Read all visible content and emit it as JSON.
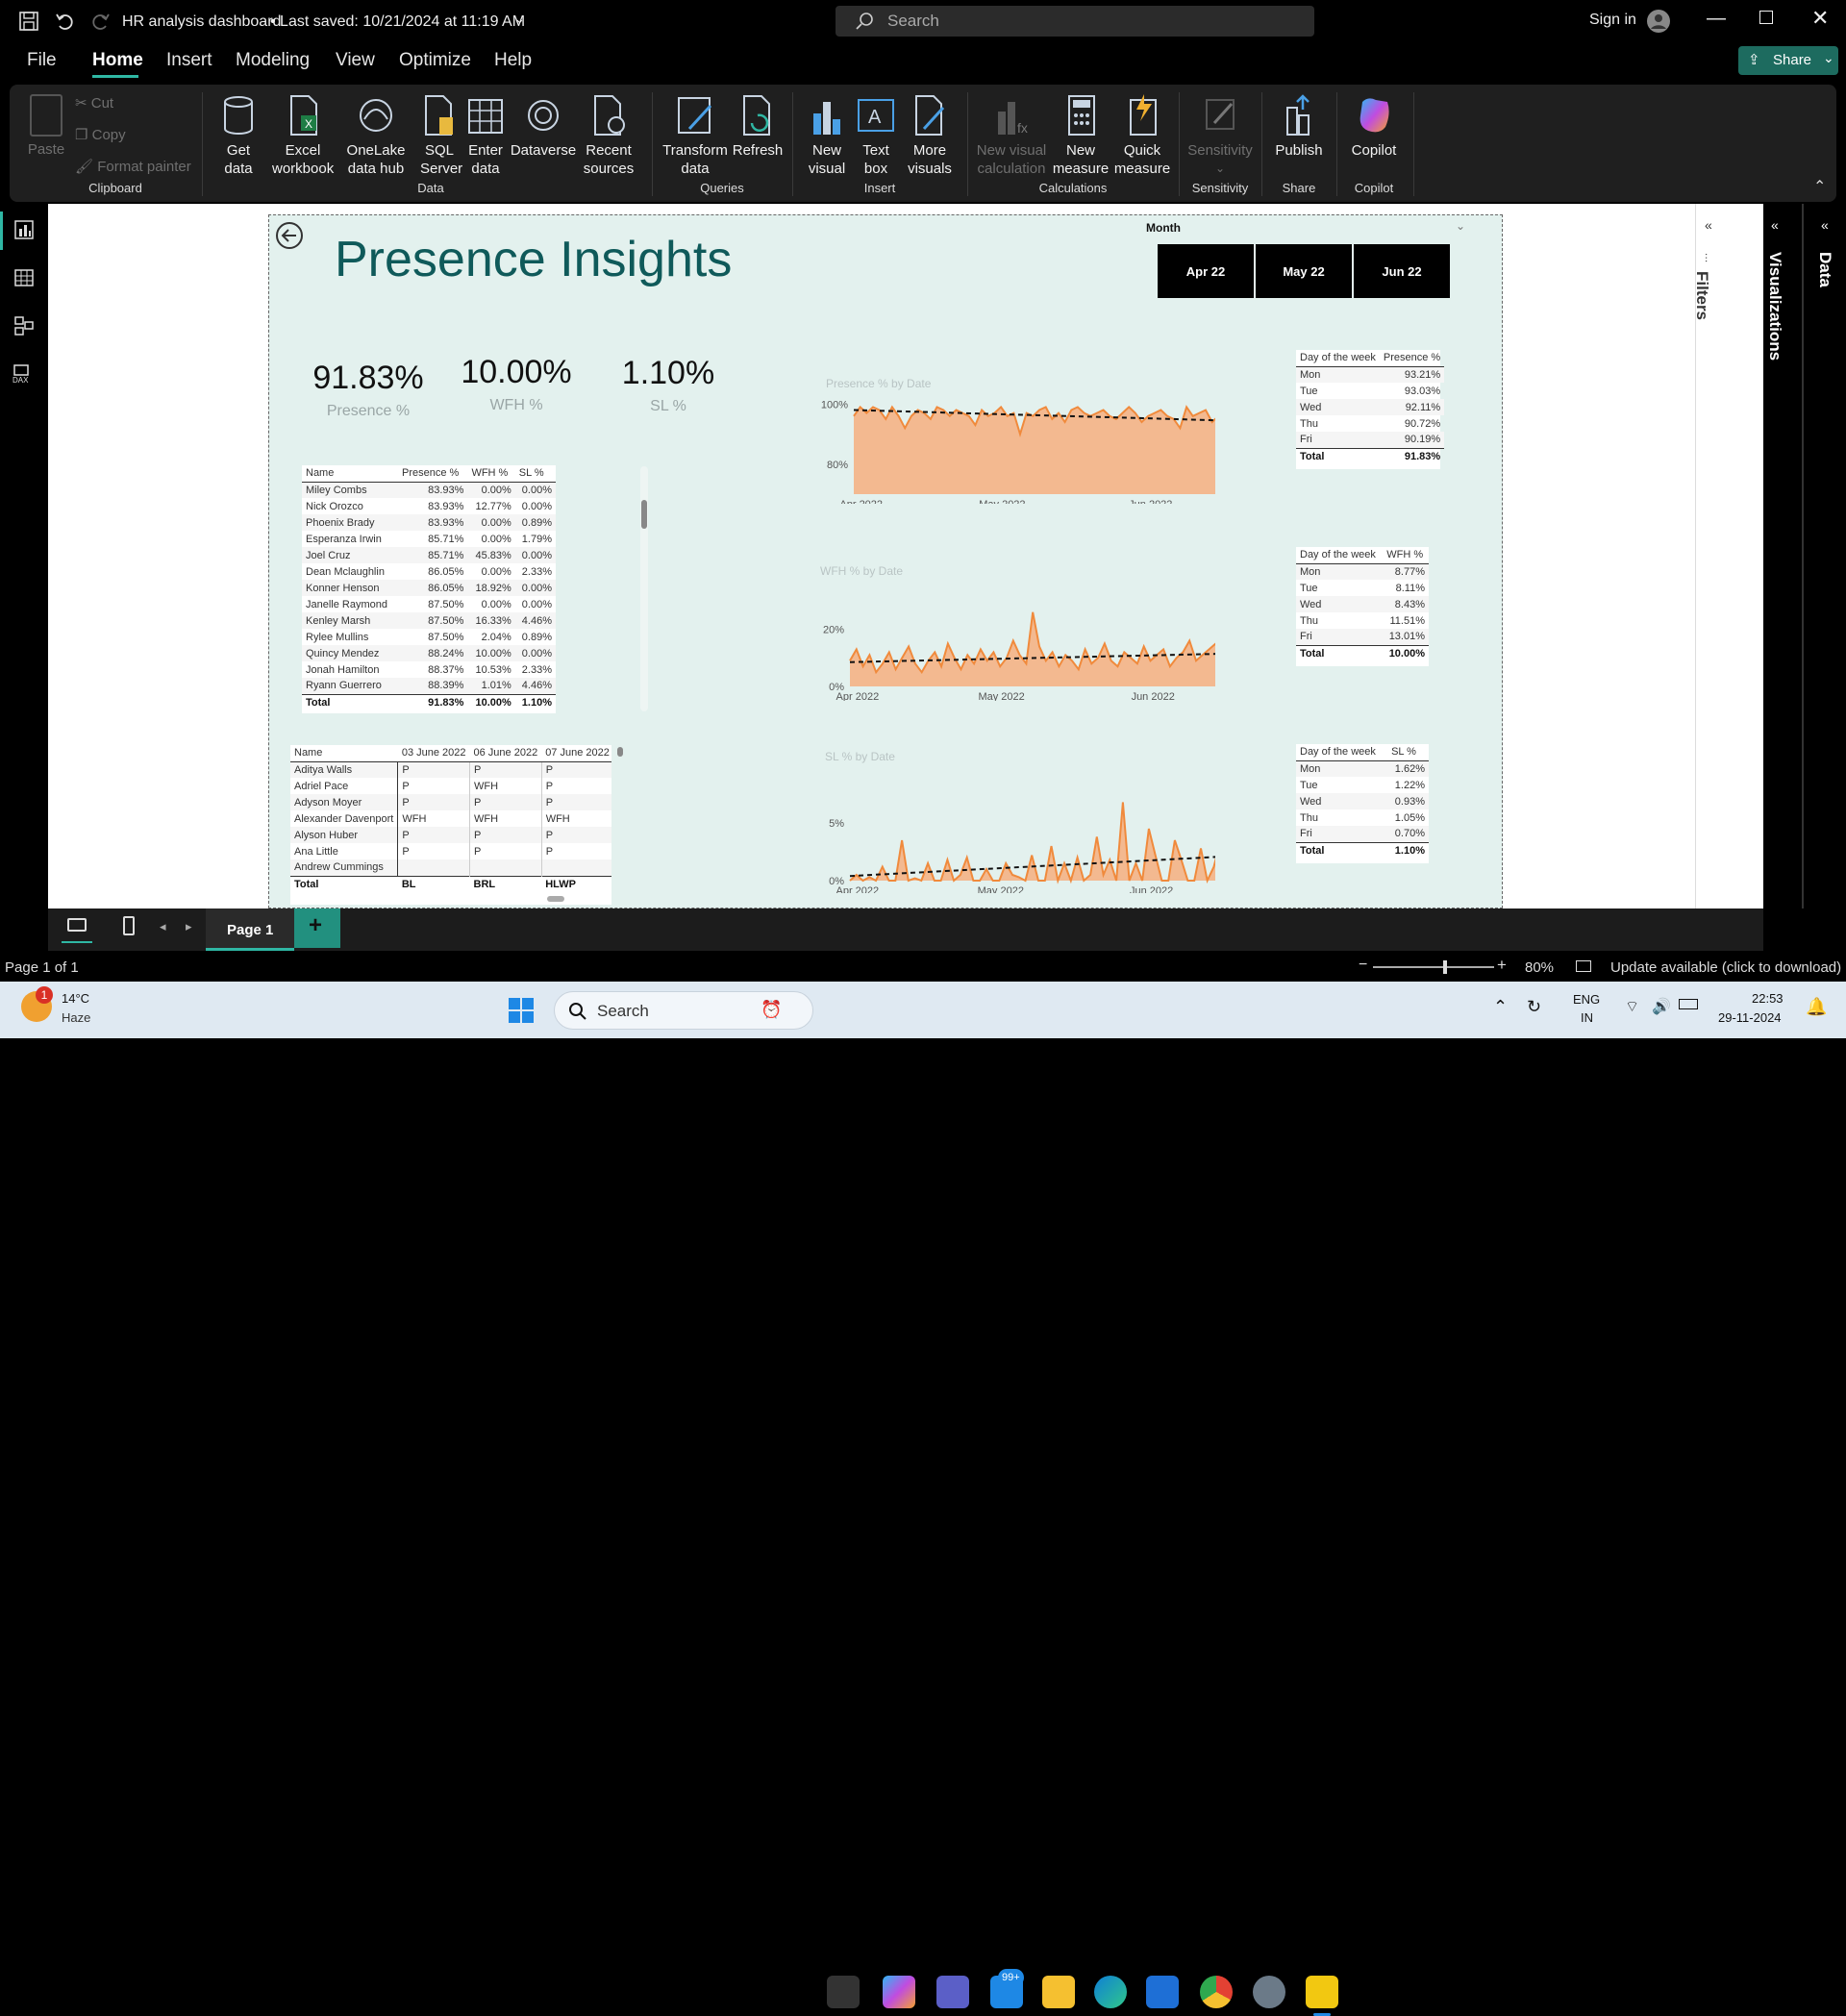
{
  "titlebar": {
    "title": "HR analysis dashboard",
    "saved": "• Last saved: 10/21/2024 at 11:19 AM",
    "search_placeholder": "Search",
    "signin": "Sign in"
  },
  "menu": {
    "items": [
      "File",
      "Home",
      "Insert",
      "Modeling",
      "View",
      "Optimize",
      "Help"
    ],
    "share": "Share"
  },
  "ribbon": {
    "clipboard": {
      "paste": "Paste",
      "cut": "Cut",
      "copy": "Copy",
      "format_painter": "Format painter",
      "group": "Clipboard"
    },
    "data": {
      "get_data": "Get data",
      "excel": "Excel workbook",
      "onelake": "OneLake data hub",
      "sql": "SQL Server",
      "enter": "Enter data",
      "dataverse": "Dataverse",
      "recent": "Recent sources",
      "group": "Data"
    },
    "queries": {
      "transform": "Transform data",
      "refresh": "Refresh",
      "group": "Queries"
    },
    "insert": {
      "new_visual": "New visual",
      "text_box": "Text box",
      "more_visuals": "More visuals",
      "group": "Insert"
    },
    "calculations": {
      "new_visual_calc": "New visual calculation",
      "new_measure": "New measure",
      "quick_measure": "Quick measure",
      "group": "Calculations"
    },
    "sensitivity": {
      "label": "Sensitivity",
      "group": "Sensitivity"
    },
    "share": {
      "publish": "Publish",
      "group": "Share"
    },
    "copilot": {
      "label": "Copilot",
      "group": "Copilot"
    }
  },
  "report": {
    "title": "Presence Insights",
    "month_label": "Month",
    "months": [
      "Apr 22",
      "May 22",
      "Jun 22"
    ],
    "kpis": [
      {
        "value": "91.83%",
        "label": "Presence %"
      },
      {
        "value": "10.00%",
        "label": "WFH %"
      },
      {
        "value": "1.10%",
        "label": "SL %"
      }
    ],
    "emp_table": {
      "headers": [
        "Name",
        "Presence %",
        "WFH %",
        "SL %"
      ],
      "rows": [
        [
          "Miley Combs",
          "83.93%",
          "0.00%",
          "0.00%"
        ],
        [
          "Nick Orozco",
          "83.93%",
          "12.77%",
          "0.00%"
        ],
        [
          "Phoenix Brady",
          "83.93%",
          "0.00%",
          "0.89%"
        ],
        [
          "Esperanza Irwin",
          "85.71%",
          "0.00%",
          "1.79%"
        ],
        [
          "Joel Cruz",
          "85.71%",
          "45.83%",
          "0.00%"
        ],
        [
          "Dean Mclaughlin",
          "86.05%",
          "0.00%",
          "2.33%"
        ],
        [
          "Konner Henson",
          "86.05%",
          "18.92%",
          "0.00%"
        ],
        [
          "Janelle Raymond",
          "87.50%",
          "0.00%",
          "0.00%"
        ],
        [
          "Kenley Marsh",
          "87.50%",
          "16.33%",
          "4.46%"
        ],
        [
          "Rylee Mullins",
          "87.50%",
          "2.04%",
          "0.89%"
        ],
        [
          "Quincy Mendez",
          "88.24%",
          "10.00%",
          "0.00%"
        ],
        [
          "Jonah Hamilton",
          "88.37%",
          "10.53%",
          "2.33%"
        ],
        [
          "Ryann Guerrero",
          "88.39%",
          "1.01%",
          "4.46%"
        ]
      ],
      "total": [
        "Total",
        "91.83%",
        "10.00%",
        "1.10%"
      ]
    },
    "att_table": {
      "headers": [
        "Name",
        "03 June 2022",
        "06 June 2022",
        "07 June 2022"
      ],
      "rows": [
        [
          "Aditya Walls",
          "P",
          "P",
          "P"
        ],
        [
          "Adriel Pace",
          "P",
          "WFH",
          "P"
        ],
        [
          "Adyson Moyer",
          "P",
          "P",
          "P"
        ],
        [
          "Alexander Davenport",
          "WFH",
          "WFH",
          "WFH"
        ],
        [
          "Alyson Huber",
          "P",
          "P",
          "P"
        ],
        [
          "Ana Little",
          "P",
          "P",
          "P"
        ],
        [
          "Andrew Cummings",
          "",
          "",
          ""
        ]
      ],
      "total": [
        "Total",
        "BL",
        "BRL",
        "HLWP"
      ]
    },
    "dow_tables": [
      {
        "headers": [
          "Day of the week",
          "Presence %"
        ],
        "rows": [
          [
            "Mon",
            "93.21%"
          ],
          [
            "Tue",
            "93.03%"
          ],
          [
            "Wed",
            "92.11%"
          ],
          [
            "Thu",
            "90.72%"
          ],
          [
            "Fri",
            "90.19%"
          ]
        ],
        "total": [
          "Total",
          "91.83%"
        ]
      },
      {
        "headers": [
          "Day of the week",
          "WFH %"
        ],
        "rows": [
          [
            "Mon",
            "8.77%"
          ],
          [
            "Tue",
            "8.11%"
          ],
          [
            "Wed",
            "8.43%"
          ],
          [
            "Thu",
            "11.51%"
          ],
          [
            "Fri",
            "13.01%"
          ]
        ],
        "total": [
          "Total",
          "10.00%"
        ]
      },
      {
        "headers": [
          "Day of the week",
          "SL %"
        ],
        "rows": [
          [
            "Mon",
            "1.62%"
          ],
          [
            "Tue",
            "1.22%"
          ],
          [
            "Wed",
            "0.93%"
          ],
          [
            "Thu",
            "1.05%"
          ],
          [
            "Fri",
            "0.70%"
          ]
        ],
        "total": [
          "Total",
          "1.10%"
        ]
      }
    ]
  },
  "chart_data": [
    {
      "type": "area",
      "title": "Presence % by Date",
      "x_ticks": [
        "Apr 2022",
        "May 2022",
        "Jun 2022"
      ],
      "y_ticks": [
        "80%",
        "100%"
      ],
      "ylim": [
        70,
        102
      ],
      "values": [
        96,
        99,
        97,
        99,
        98,
        95,
        99,
        96,
        92,
        96,
        98,
        97,
        95,
        99,
        98,
        96,
        98,
        97,
        96,
        93,
        98,
        96,
        97,
        99,
        96,
        97,
        90,
        97,
        96,
        98,
        99,
        95,
        97,
        94,
        98,
        99,
        97,
        96,
        97,
        98,
        96,
        95,
        97,
        99,
        97,
        94,
        96,
        97,
        98,
        96,
        95,
        92,
        99,
        96,
        97,
        98,
        94,
        96,
        95
      ],
      "trend": [
        98,
        94.5
      ],
      "color": "#f08a3c"
    },
    {
      "type": "area",
      "title": "WFH % by Date",
      "x_ticks": [
        "Apr 2022",
        "May 2022",
        "Jun 2022"
      ],
      "y_ticks": [
        "0%",
        "20%"
      ],
      "ylim": [
        0,
        32
      ],
      "values": [
        9,
        13,
        7,
        11,
        5,
        8,
        12,
        6,
        10,
        14,
        8,
        5,
        9,
        12,
        7,
        15,
        10,
        6,
        11,
        8,
        13,
        9,
        12,
        7,
        10,
        16,
        11,
        8,
        26,
        14,
        9,
        12,
        7,
        11,
        9,
        6,
        13,
        8,
        10,
        15,
        9,
        7,
        12,
        10,
        8,
        14,
        9,
        11,
        13,
        7,
        10,
        12,
        16,
        9,
        11,
        13,
        15,
        10,
        18
      ],
      "trend": [
        8.5,
        11.5
      ],
      "color": "#f08a3c"
    },
    {
      "type": "area",
      "title": "SL % by Date",
      "x_ticks": [
        "Apr 2022",
        "May 2022",
        "Jun 2022"
      ],
      "y_ticks": [
        "0%",
        "5%"
      ],
      "ylim": [
        0,
        8.5
      ],
      "values": [
        0,
        0.5,
        0,
        0.3,
        0,
        1.2,
        0,
        0,
        3.5,
        0,
        0.2,
        0,
        1.5,
        0,
        0,
        1.8,
        0,
        0.5,
        2,
        0,
        0,
        1,
        0,
        0,
        1.5,
        0.5,
        0.3,
        0,
        2.2,
        0,
        0,
        3,
        0,
        1.5,
        0,
        2,
        0,
        0.5,
        3.8,
        0.5,
        1.8,
        0,
        6.8,
        0,
        1.5,
        0,
        4.5,
        2.2,
        0,
        0,
        3.5,
        1.8,
        0,
        0,
        2.8,
        0,
        1.2,
        3.4,
        1.6
      ],
      "trend": [
        0.4,
        2.1
      ],
      "color": "#f08a3c"
    }
  ],
  "right_panels": {
    "filters": "Filters",
    "visualizations": "Visualizations",
    "data": "Data"
  },
  "pagebar": {
    "page_tab": "Page 1",
    "add": "+"
  },
  "statusbar": {
    "page_of": "Page 1 of 1",
    "zoom": "80%",
    "update": "Update available (click to download)"
  },
  "taskbar": {
    "weather_temp": "14°C",
    "weather_desc": "Haze",
    "weather_badge": "1",
    "search": "Search",
    "mail_badge": "99+",
    "lang1": "ENG",
    "lang2": "IN",
    "time": "22:53",
    "date": "29-11-2024"
  }
}
